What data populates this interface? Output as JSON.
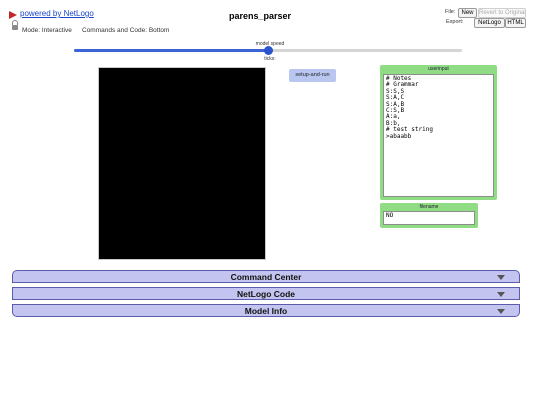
{
  "header": {
    "powered_by": "powered by NetLogo",
    "mode": "Mode: Interactive",
    "commands_position": "Commands and Code: Bottom",
    "title": "parens_parser"
  },
  "file_menu": {
    "file_label": "File:",
    "new_label": "New",
    "revert_label": "Revert to Original",
    "export_label": "Export:",
    "netlogo_label": "NetLogo",
    "html_label": "HTML"
  },
  "speed": {
    "label": "model speed",
    "ticks_label": "ticks:",
    "value": 0.5
  },
  "buttons": {
    "setup_and_run": "setup-and-run"
  },
  "inputs": {
    "userinput_label": "userinput",
    "userinput_value": "# Notes\n# Grammar\nS:S,S\nS:A,C\nS:A,B\nC:S,B\nA:a,\nB:b,\n# test string\n>abaabb",
    "filename_label": "filename",
    "filename_value": "NO"
  },
  "accordion": {
    "command_center": "Command Center",
    "netlogo_code": "NetLogo Code",
    "model_info": "Model Info"
  },
  "colors": {
    "input_panel": "#8fdc84",
    "button_bg": "#b9c7f0",
    "accordion_bg": "#c4c4f0",
    "slider_fill": "#3b63d8"
  }
}
